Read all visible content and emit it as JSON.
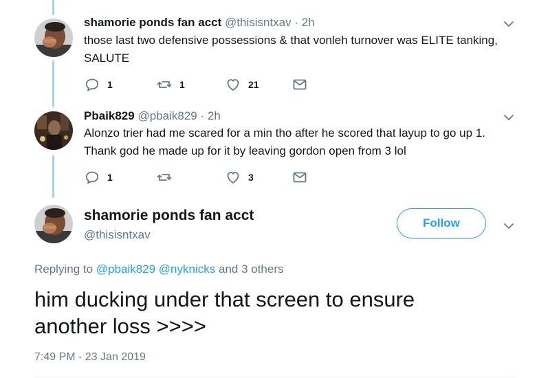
{
  "thread": [
    {
      "name": "shamorie ponds fan acct",
      "handle": "@thisisntxav",
      "separator": "·",
      "time": "2h",
      "text_lines": [
        "those last two defensive possessions & that vonleh turnover was ELITE tanking,",
        "SALUTE"
      ],
      "reply_count": "1",
      "retweet_count": "1",
      "like_count": "21"
    },
    {
      "name": "Pbaik829",
      "handle": "@pbaik829",
      "separator": "·",
      "time": "2h",
      "text_lines": [
        "Alonzo trier had me scared for a min tho after he scored that layup to go up 1.",
        "Thank god he made up for it by leaving gordon open from 3 lol"
      ],
      "reply_count": "1",
      "retweet_count": "",
      "like_count": "3"
    }
  ],
  "main_tweet": {
    "name": "shamorie ponds fan acct",
    "handle": "@thisisntxav",
    "follow_label": "Follow",
    "replying_prefix": "Replying to",
    "replying_mentions": [
      "@pbaik829",
      "@nyknicks"
    ],
    "replying_suffix": "and 3 others",
    "text_lines": [
      "him ducking under that screen to ensure",
      "another loss >>>>"
    ],
    "timestamp": "7:49 PM - 23 Jan 2019"
  },
  "colors": {
    "accent": "#1da1f2",
    "thread_line": "#9fd4f5",
    "secondary_text": "#657786",
    "primary_text": "#14171a"
  },
  "icons": {
    "reply": "reply-icon",
    "retweet": "retweet-icon",
    "like": "heart-icon",
    "dm": "envelope-icon",
    "menu": "chevron-down-icon"
  }
}
